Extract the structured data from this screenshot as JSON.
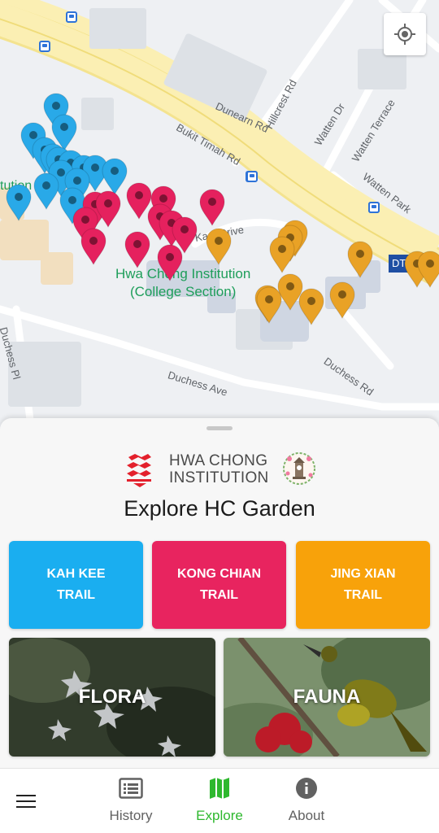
{
  "map": {
    "streets": {
      "dunearn": "Dunearn Rd",
      "bukit_timah": "Bukit Timah Rd",
      "hillcrest": "Hillcrest Rd",
      "watten_dr": "Watten Dr",
      "watten_terrace": "Watten Terrace",
      "watten_park": "Watten Park",
      "kah_drive": "Ka   e Drive",
      "duchess_pl": "Duchess Pl",
      "duchess_ave": "Duchess Ave",
      "duchess_rd": "Duchess Rd"
    },
    "campus": {
      "line1": "Hwa Chong Institution",
      "line2": "(College Section)",
      "partial": "tution"
    },
    "station_badge": "DT",
    "pin_colors": {
      "kah_kee": "#29a9e8",
      "kong_chian": "#e5215e",
      "jing_xian": "#e9a226"
    },
    "locate_icon": "my-location-icon"
  },
  "sheet": {
    "brand_line1": "HWA CHONG",
    "brand_line2": "INSTITUTION",
    "title": "Explore HC Garden",
    "trails": [
      {
        "line1": "KAH KEE",
        "line2": "TRAIL",
        "color": "#1aaef0"
      },
      {
        "line1": "KONG CHIAN",
        "line2": "TRAIL",
        "color": "#e8245f"
      },
      {
        "line1": "JING XIAN",
        "line2": "TRAIL",
        "color": "#f8a20a"
      }
    ],
    "categories": [
      {
        "label": "FLORA"
      },
      {
        "label": "FAUNA"
      }
    ]
  },
  "nav": {
    "menu_icon": "hamburger-icon",
    "items": [
      {
        "label": "History",
        "icon": "list-icon",
        "active": false
      },
      {
        "label": "Explore",
        "icon": "map-icon",
        "active": true
      },
      {
        "label": "About",
        "icon": "info-icon",
        "active": false
      }
    ],
    "active_color": "#2eb82e",
    "inactive_color": "#616161"
  }
}
